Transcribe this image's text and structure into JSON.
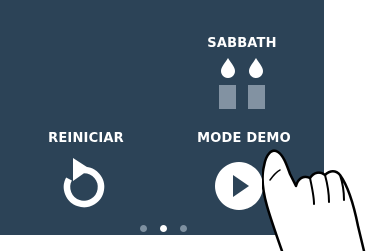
{
  "tiles": {
    "sabbath": {
      "label": "SABBATH",
      "icon": "candles-icon"
    },
    "restart": {
      "label": "REINICIAR",
      "icon": "restart-icon"
    },
    "demo": {
      "label": "MODE DEMO",
      "icon": "play-icon"
    }
  },
  "pager": {
    "pages": 3,
    "active_page": 2
  },
  "colors": {
    "panel": "#2c4357",
    "text": "#ffffff",
    "candle_base": "#8292a2",
    "dot_inactive": "#7e90a0",
    "dot_active": "#ffffff"
  }
}
